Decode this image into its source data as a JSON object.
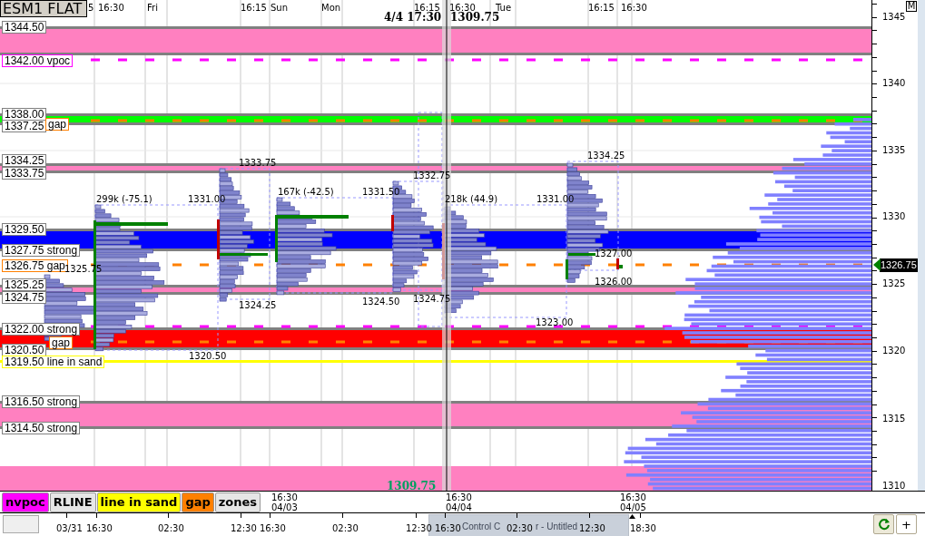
{
  "symbol": "ESM1 FLAT",
  "top_times": [
    "5",
    "16:30",
    "Fri",
    "16:15",
    "Sun",
    "Mon",
    "16:15",
    "16:30",
    "Tue",
    "16:15",
    "16:30"
  ],
  "crosshair": {
    "time": "4/4 17:30",
    "price": "1309.75"
  },
  "levels": [
    {
      "label": "1344.50",
      "kind": "plain"
    },
    {
      "label": "1342.00 vpoc",
      "kind": "vpoc"
    },
    {
      "label": "1338.00",
      "kind": "plain"
    },
    {
      "label": "1337.25",
      "kind": "plain"
    },
    {
      "label": "gap",
      "kind": "gap"
    },
    {
      "label": "1334.25",
      "kind": "plain"
    },
    {
      "label": "1333.75",
      "kind": "plain"
    },
    {
      "label": "1329.50",
      "kind": "plain"
    },
    {
      "label": "1327.75 strong",
      "kind": "plain"
    },
    {
      "label": "1326.75 gap",
      "kind": "gap"
    },
    {
      "label": "1325.25",
      "kind": "plain"
    },
    {
      "label": "1324.75",
      "kind": "plain"
    },
    {
      "label": "1322.00 strong",
      "kind": "plain"
    },
    {
      "label": "1320.50",
      "kind": "plain"
    },
    {
      "label": "gap",
      "kind": "gap"
    },
    {
      "label": "1319.50 line in sand",
      "kind": "sand"
    },
    {
      "label": "1316.50 strong",
      "kind": "plain"
    },
    {
      "label": "1314.50 strong",
      "kind": "plain"
    }
  ],
  "session_labels": [
    "299k (-75.1)",
    "1331.00",
    "1333.75",
    "167k (-42.5)",
    "1331.50",
    "1332.75",
    "218k (44.9)",
    "1331.00",
    "1334.25",
    "1327.00",
    "1326.00",
    "1325.75",
    "1324.25",
    "1324.50",
    "1324.75",
    "1323.00",
    "1320.50"
  ],
  "cursor_price": "1309.75",
  "price_axis": [
    "1345",
    "1340",
    "1335",
    "1330",
    "1325",
    "1320",
    "1315",
    "1310"
  ],
  "current_price": "1326.75",
  "menu_button": "M",
  "legend": [
    {
      "label": "nvpoc",
      "color": "#ff00ff"
    },
    {
      "label": "RLINE",
      "color": "#e6e6e6"
    },
    {
      "label": "line in sand",
      "color": "#ffff00"
    },
    {
      "label": "gap",
      "color": "#ff8000"
    },
    {
      "label": "zones",
      "color": "#e6e6e6"
    }
  ],
  "chart_dates": [
    {
      "time": "16:30",
      "date": "04/03"
    },
    {
      "time": "16:30",
      "date": "04/04"
    },
    {
      "time": "16:30",
      "date": "04/05"
    }
  ],
  "time_axis": [
    "03/31",
    "16:30",
    "02:30",
    "12:30",
    "16:30",
    "02:30",
    "12:30",
    "16:30",
    "02:30",
    "12:30",
    "18:30"
  ],
  "taskbar_popup": [
    "Control C",
    "r - Untitled"
  ],
  "zoom_button": "+"
}
